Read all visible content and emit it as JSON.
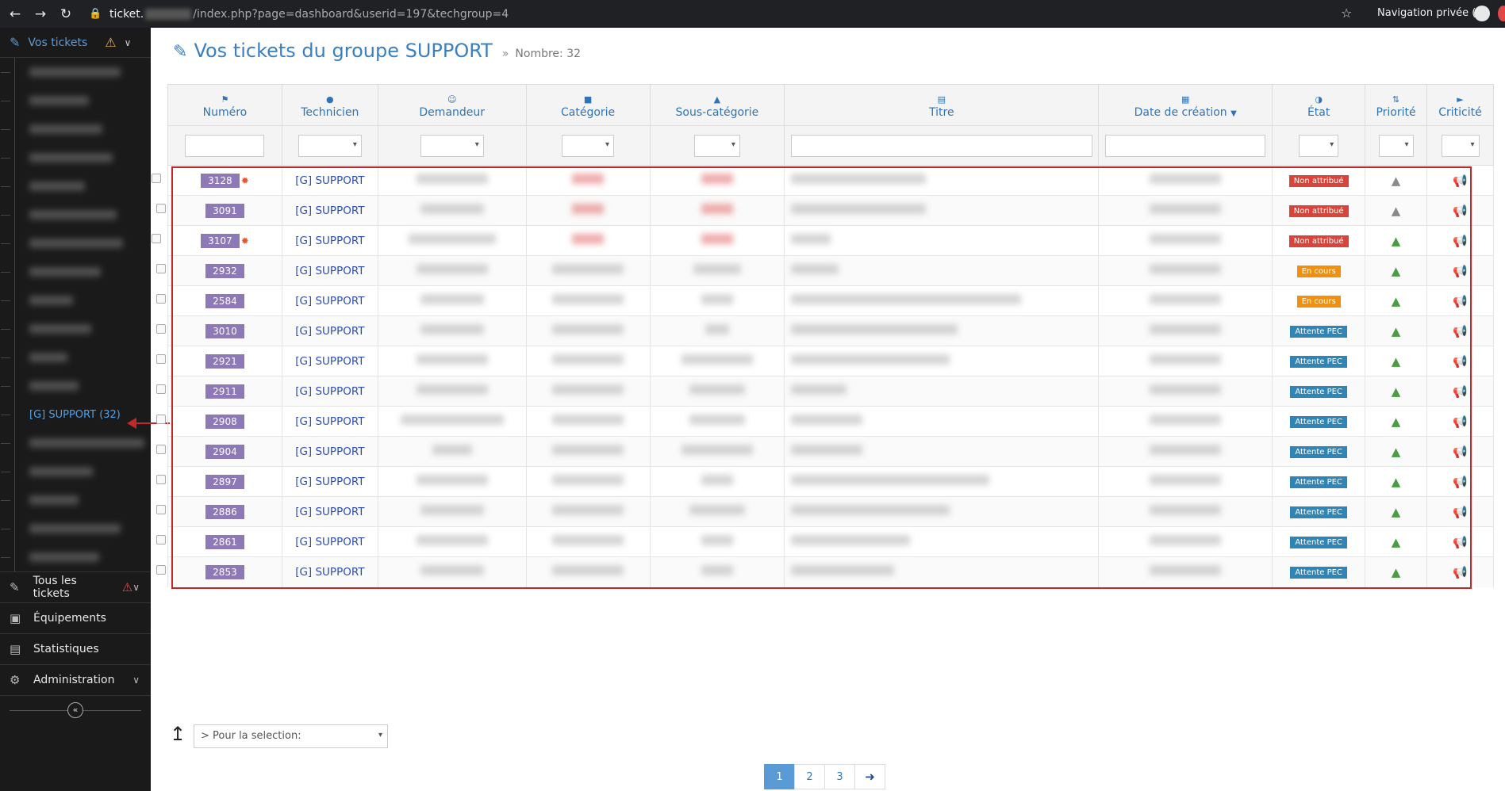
{
  "browser": {
    "url_host": "ticket.",
    "url_path": "/index.php?page=dashboard&userid=197&techgroup=4",
    "private_label": "Navigation privée (2)"
  },
  "sidebar": {
    "header_label": "Vos tickets",
    "active_item": "[G] SUPPORT (32)",
    "sections": [
      {
        "label": "Tous les tickets"
      },
      {
        "label": "Équipements"
      },
      {
        "label": "Statistiques"
      },
      {
        "label": "Administration"
      }
    ]
  },
  "page": {
    "title": "Vos tickets du groupe SUPPORT",
    "separator": "»",
    "count_label": "Nombre: 32"
  },
  "table": {
    "headers": [
      "Numéro",
      "Technicien",
      "Demandeur",
      "Catégorie",
      "Sous-catégorie",
      "Titre",
      "Date de création",
      "État",
      "Priorité",
      "Criticité"
    ],
    "rows": [
      {
        "num": "3128",
        "new": true,
        "tech": "[G] SUPPORT",
        "state": "Non attribué",
        "state_kind": "na",
        "prio_green": false
      },
      {
        "num": "3091",
        "new": false,
        "tech": "[G] SUPPORT",
        "state": "Non attribué",
        "state_kind": "na",
        "prio_green": false
      },
      {
        "num": "3107",
        "new": true,
        "tech": "[G] SUPPORT",
        "state": "Non attribué",
        "state_kind": "na",
        "prio_green": true
      },
      {
        "num": "2932",
        "new": false,
        "tech": "[G] SUPPORT",
        "state": "En cours",
        "state_kind": "ec",
        "prio_green": true
      },
      {
        "num": "2584",
        "new": false,
        "tech": "[G] SUPPORT",
        "state": "En cours",
        "state_kind": "ec",
        "prio_green": true
      },
      {
        "num": "3010",
        "new": false,
        "tech": "[G] SUPPORT",
        "state": "Attente PEC",
        "state_kind": "ap",
        "prio_green": true
      },
      {
        "num": "2921",
        "new": false,
        "tech": "[G] SUPPORT",
        "state": "Attente PEC",
        "state_kind": "ap",
        "prio_green": true
      },
      {
        "num": "2911",
        "new": false,
        "tech": "[G] SUPPORT",
        "state": "Attente PEC",
        "state_kind": "ap",
        "prio_green": true
      },
      {
        "num": "2908",
        "new": false,
        "tech": "[G] SUPPORT",
        "state": "Attente PEC",
        "state_kind": "ap",
        "prio_green": true
      },
      {
        "num": "2904",
        "new": false,
        "tech": "[G] SUPPORT",
        "state": "Attente PEC",
        "state_kind": "ap",
        "prio_green": true
      },
      {
        "num": "2897",
        "new": false,
        "tech": "[G] SUPPORT",
        "state": "Attente PEC",
        "state_kind": "ap",
        "prio_green": true
      },
      {
        "num": "2886",
        "new": false,
        "tech": "[G] SUPPORT",
        "state": "Attente PEC",
        "state_kind": "ap",
        "prio_green": true
      },
      {
        "num": "2861",
        "new": false,
        "tech": "[G] SUPPORT",
        "state": "Attente PEC",
        "state_kind": "ap",
        "prio_green": true
      },
      {
        "num": "2853",
        "new": false,
        "tech": "[G] SUPPORT",
        "state": "Attente PEC",
        "state_kind": "ap",
        "prio_green": true
      }
    ]
  },
  "bulk_action": {
    "placeholder": "> Pour la selection:"
  },
  "pagination": {
    "pages": [
      "1",
      "2",
      "3"
    ],
    "current": "1"
  },
  "colors": {
    "accent": "#3a7fc1",
    "badge": "#8e79b7",
    "state_na": "#d9443a",
    "state_ec": "#f0900c",
    "state_ap": "#2f86b6",
    "annotation": "#c0282a"
  }
}
